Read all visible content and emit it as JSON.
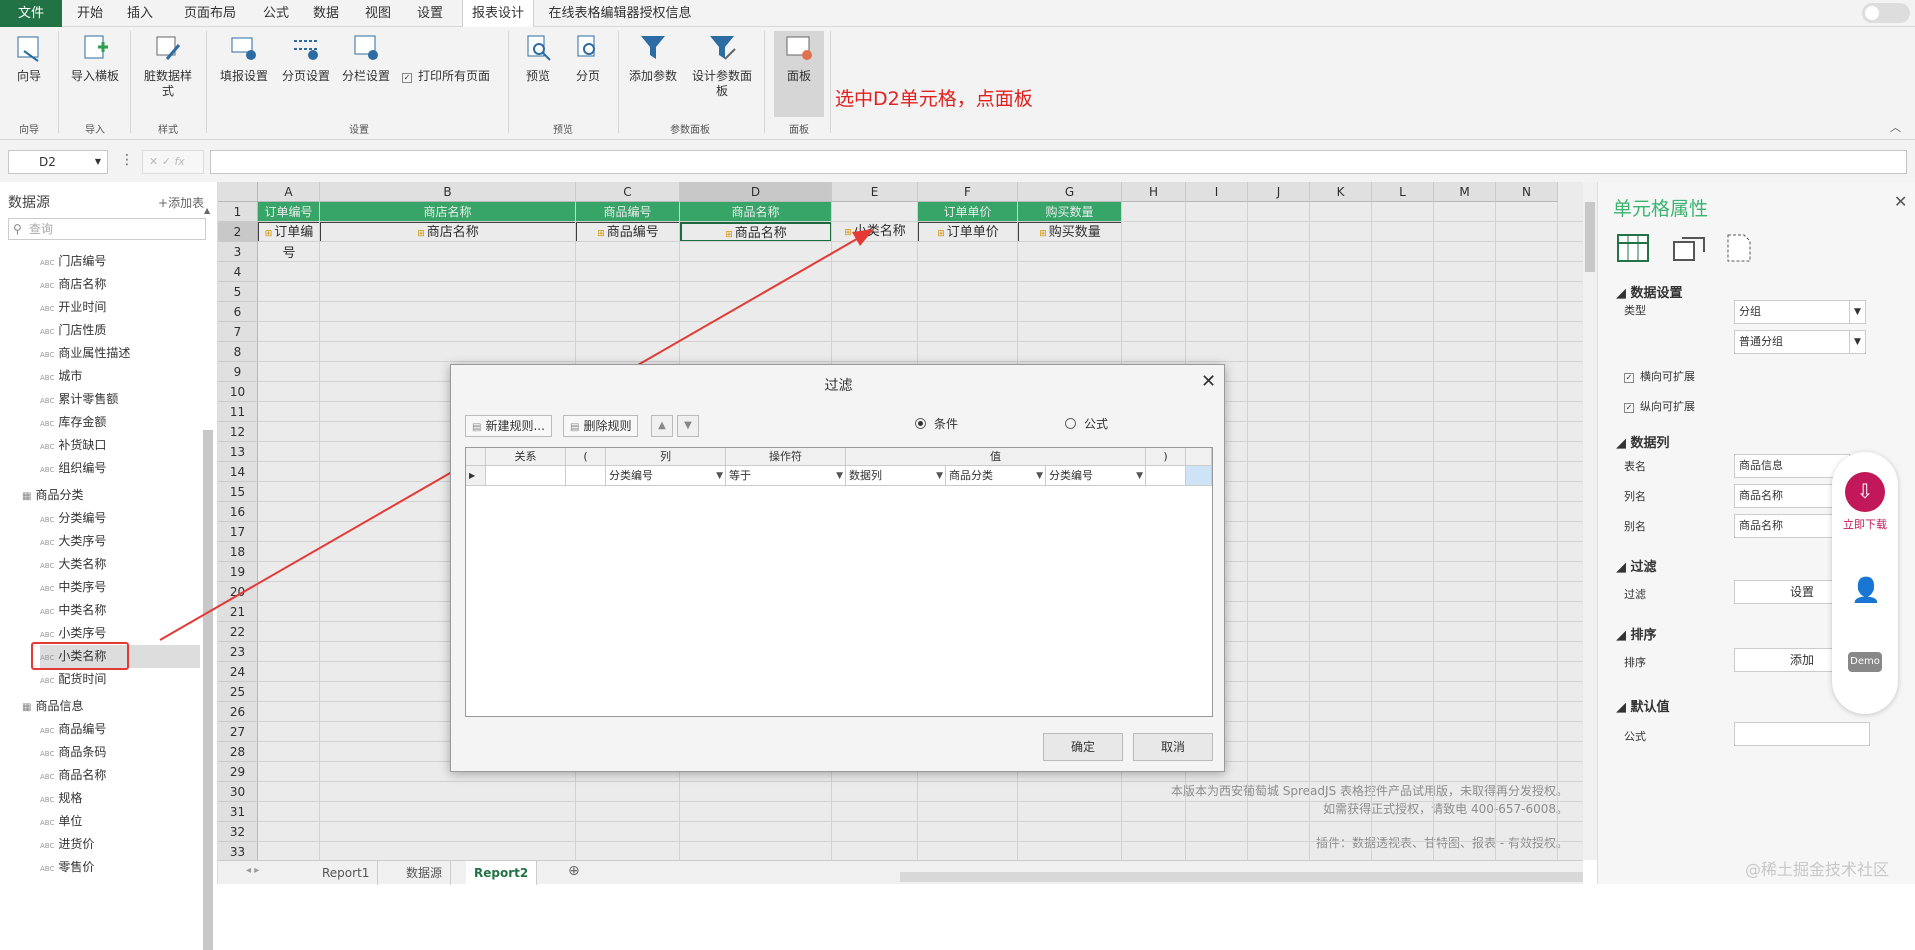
{
  "menu": {
    "file": "文件",
    "start": "开始",
    "insert": "插入",
    "page_layout": "页面布局",
    "formula": "公式",
    "data": "数据",
    "view": "视图",
    "settings": "设置",
    "report_design": "报表设计",
    "license": "在线表格编辑器授权信息"
  },
  "ribbon": {
    "wizard": "向导",
    "import_template": "导入横板",
    "dirty_style": "脏数据样式",
    "fill_settings": "填报设置",
    "page_settings": "分页设置",
    "column_settings": "分栏设置",
    "print_all": "打印所有页面",
    "preview": "预览",
    "paging": "分页",
    "add_param": "添加参数",
    "design_param_panel": "设计参数面板",
    "panel": "面板",
    "groups": {
      "wizard": "向导",
      "import": "导入",
      "style": "样式",
      "settings": "设置",
      "preview": "预览",
      "param_panel": "参数面板",
      "panel": "面板"
    }
  },
  "annotation": "选中D2单元格，点面板",
  "formula_bar": {
    "name_box": "D2",
    "fx": "fx"
  },
  "datasource": {
    "title": "数据源",
    "add_table": "添加表",
    "search_placeholder": "查询",
    "items": [
      "门店编号",
      "商店名称",
      "开业时间",
      "门店性质",
      "商业属性描述",
      "城市",
      "累计零售额",
      "库存金额",
      "补货缺口",
      "组织编号"
    ],
    "table2": "商品分类",
    "table2_items": [
      "分类编号",
      "大类序号",
      "大类名称",
      "中类序号",
      "中类名称",
      "小类序号",
      "小类名称",
      "配货时间"
    ],
    "table3": "商品信息",
    "table3_items": [
      "商品编号",
      "商品条码",
      "商品名称",
      "规格",
      "单位",
      "进货价",
      "零售价"
    ]
  },
  "sheet": {
    "columns": [
      "A",
      "B",
      "C",
      "D",
      "E",
      "F",
      "G",
      "H",
      "I",
      "J",
      "K",
      "L",
      "M",
      "N"
    ],
    "rows": [
      "1",
      "2",
      "3",
      "4",
      "5",
      "6",
      "7",
      "8",
      "9",
      "10",
      "11",
      "12",
      "13",
      "14",
      "15",
      "16",
      "17",
      "18",
      "19",
      "20",
      "21",
      "22",
      "23",
      "24",
      "25",
      "26",
      "27",
      "28",
      "29",
      "30",
      "31",
      "32",
      "33"
    ],
    "header_row": {
      "a": "订单编号",
      "b": "商店名称",
      "c": "商品编号",
      "d": "商品名称",
      "f": "订单单价",
      "g": "购买数量"
    },
    "row2": {
      "a": "订单编号",
      "b": "商店名称",
      "c": "商品编号",
      "d": "商品名称",
      "e": "小类名称",
      "f": "订单单价",
      "g": "购买数量"
    },
    "watermark": [
      "本版本为西安葡萄城 SpreadJS 表格控件产品试用版，未取得再分发授权。",
      "如需获得正式授权，请致电 400-657-6008。",
      "插件：数据透视表、甘特图、报表 - 有效授权。"
    ],
    "tabs": [
      "Report1",
      "数据源",
      "Report2"
    ]
  },
  "dialog": {
    "title": "过滤",
    "new_rule": "新建规则...",
    "delete_rule": "删除规则",
    "radio_condition": "条件",
    "radio_formula": "公式",
    "headers": {
      "relation": "关系",
      "lparen": "(",
      "column": "列",
      "operator": "操作符",
      "value": "值",
      "rparen": ")"
    },
    "row": {
      "column": "分类编号",
      "operator": "等于",
      "value_type": "数据列",
      "value_table": "商品分类",
      "value_column": "分类编号"
    },
    "ok": "确定",
    "cancel": "取消"
  },
  "properties": {
    "title": "单元格属性",
    "data_settings": "数据设置",
    "type_label": "类型",
    "type_value": "分组",
    "group_value": "普通分组",
    "h_expand": "横向可扩展",
    "v_expand": "纵向可扩展",
    "data_column": "数据列",
    "table_label": "表名",
    "table_value": "商品信息",
    "column_label": "列名",
    "column_value": "商品名称",
    "alias_label": "别名",
    "alias_value": "商品名称",
    "filter": "过滤",
    "filter_label": "过滤",
    "filter_btn": "设置",
    "sort": "排序",
    "sort_label": "排序",
    "sort_btn": "添加",
    "default_value": "默认值",
    "formula_label": "公式"
  },
  "floating": {
    "download": "立即下载",
    "demo": "Demo"
  },
  "credit": "@稀土掘金技术社区",
  "colors": {
    "green": "#217346",
    "header_green": "#3cb371",
    "annotation_red": "#e02020",
    "arrow_red": "#e53935"
  }
}
